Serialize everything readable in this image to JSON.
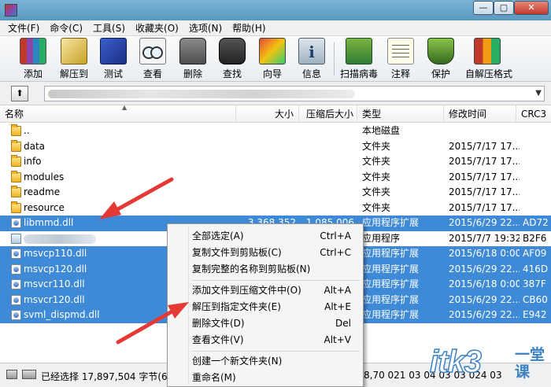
{
  "window": {
    "min_glyph": "—",
    "max_glyph": "▢",
    "close_glyph": "✕"
  },
  "menu": [
    "文件(F)",
    "命令(C)",
    "工具(S)",
    "收藏夹(O)",
    "选项(N)",
    "帮助(H)"
  ],
  "toolbar": [
    {
      "label": "添加",
      "icon": "add-archive-icon"
    },
    {
      "label": "解压到",
      "icon": "extract-to-icon"
    },
    {
      "label": "测试",
      "icon": "test-icon"
    },
    {
      "label": "查看",
      "icon": "view-icon"
    },
    {
      "label": "删除",
      "icon": "delete-icon"
    },
    {
      "label": "查找",
      "icon": "find-icon"
    },
    {
      "label": "向导",
      "icon": "wizard-icon"
    },
    {
      "label": "信息",
      "icon": "info-icon"
    },
    {
      "label": "扫描病毒",
      "icon": "scan-virus-icon"
    },
    {
      "label": "注释",
      "icon": "comment-icon"
    },
    {
      "label": "保护",
      "icon": "protect-icon"
    },
    {
      "label": "自解压格式",
      "icon": "sfx-icon"
    }
  ],
  "address": {
    "up_glyph": "⬆",
    "dropdown_glyph": "▼"
  },
  "columns": {
    "name": "名称",
    "size": "大小",
    "packed": "压缩后大小",
    "type": "类型",
    "modified": "修改时间",
    "crc": "CRC3",
    "sort_glyph": "▲"
  },
  "files": [
    {
      "name": "..",
      "size": "",
      "packed": "",
      "type": "本地磁盘",
      "modified": "",
      "crc": "",
      "icon": "folder-icon",
      "selected": false
    },
    {
      "name": "data",
      "size": "",
      "packed": "",
      "type": "文件夹",
      "modified": "2015/7/17 17...",
      "crc": "",
      "icon": "folder-icon",
      "selected": false
    },
    {
      "name": "info",
      "size": "",
      "packed": "",
      "type": "文件夹",
      "modified": "2015/7/17 17...",
      "crc": "",
      "icon": "folder-icon",
      "selected": false
    },
    {
      "name": "modules",
      "size": "",
      "packed": "",
      "type": "文件夹",
      "modified": "2015/7/17 17...",
      "crc": "",
      "icon": "folder-icon",
      "selected": false
    },
    {
      "name": "readme",
      "size": "",
      "packed": "",
      "type": "文件夹",
      "modified": "2015/7/17 17...",
      "crc": "",
      "icon": "folder-icon",
      "selected": false
    },
    {
      "name": "resource",
      "size": "",
      "packed": "",
      "type": "文件夹",
      "modified": "2015/7/17 17...",
      "crc": "",
      "icon": "folder-icon",
      "selected": false
    },
    {
      "name": "libmmd.dll",
      "size": "3,368,352",
      "packed": "1,085,006",
      "type": "应用程序扩展",
      "modified": "2015/6/29 22...",
      "crc": "AD72",
      "icon": "dll-icon",
      "selected": true
    },
    {
      "name": "",
      "size": "",
      "packed": "",
      "type": "应用程序",
      "modified": "2015/7/7 19:32",
      "crc": "B2F6",
      "icon": "exe-icon",
      "selected": false,
      "blurred": true
    },
    {
      "name": "msvcp110.dll",
      "size": "",
      "packed": "",
      "type": "应用程序扩展",
      "modified": "2015/6/18 0:00",
      "crc": "AF09",
      "icon": "dll-icon",
      "selected": true
    },
    {
      "name": "msvcp120.dll",
      "size": "",
      "packed": "",
      "type": "应用程序扩展",
      "modified": "2015/6/29 22...",
      "crc": "416D",
      "icon": "dll-icon",
      "selected": true
    },
    {
      "name": "msvcr110.dll",
      "size": "",
      "packed": "",
      "type": "应用程序扩展",
      "modified": "2015/6/18 0:00",
      "crc": "387F",
      "icon": "dll-icon",
      "selected": true
    },
    {
      "name": "msvcr120.dll",
      "size": "",
      "packed": "",
      "type": "应用程序扩展",
      "modified": "2015/6/29 22...",
      "crc": "CB60",
      "icon": "dll-icon",
      "selected": true
    },
    {
      "name": "svml_dispmd.dll",
      "size": "",
      "packed": "",
      "type": "应用程序扩展",
      "modified": "2015/6/29 22...",
      "crc": "E942",
      "icon": "dll-icon",
      "selected": true
    }
  ],
  "context_menu": [
    {
      "label": "全部选定(A)",
      "shortcut": "Ctrl+A"
    },
    {
      "label": "复制文件到剪贴板(C)",
      "shortcut": "Ctrl+C"
    },
    {
      "label": "复制完整的名称到剪贴板(N)",
      "shortcut": ""
    },
    {
      "separator": true
    },
    {
      "label": "添加文件到压缩文件中(O)",
      "shortcut": "Alt+A"
    },
    {
      "label": "解压到指定文件夹(E)",
      "shortcut": "Alt+E"
    },
    {
      "label": "删除文件(D)",
      "shortcut": "Del"
    },
    {
      "label": "查看文件(V)",
      "shortcut": "Alt+V"
    },
    {
      "separator": true
    },
    {
      "label": "创建一个新文件夹(N)",
      "shortcut": ""
    },
    {
      "label": "重命名(M)",
      "shortcut": ""
    }
  ],
  "status": {
    "left": "已经选择 17,897,504 字节(6 个文",
    "right": "8,70 021 03 04 03 03 024 03"
  },
  "watermark": {
    "latin": "itk3",
    "cn_line1": "一堂课",
    "cn_line2": "",
    "color": "#3b82c4"
  },
  "colors": {
    "selection": "#3f8ad6",
    "arrow": "#e53935"
  }
}
